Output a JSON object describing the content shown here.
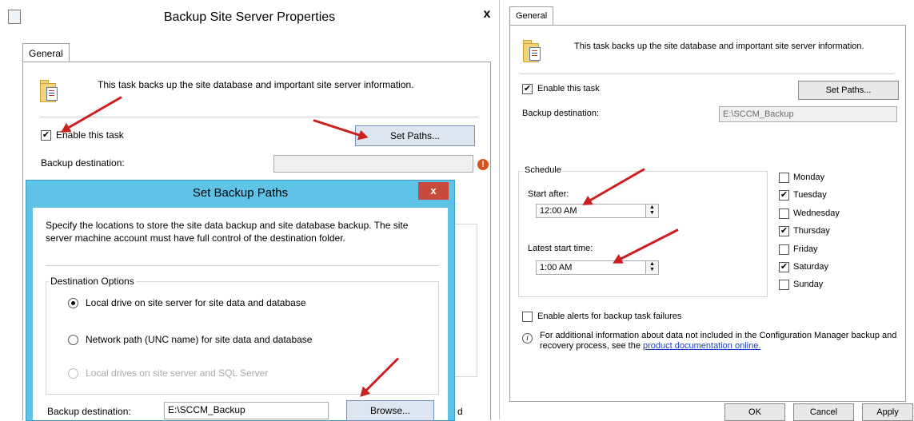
{
  "left_dialog": {
    "title": "Backup Site Server Properties",
    "close_glyph": "x",
    "tab": "General",
    "description": "This task backs up the site database and important site server information.",
    "enable_label": "Enable this task",
    "enable_checked": true,
    "set_paths_label": "Set Paths...",
    "backup_destination_label": "Backup destination:",
    "backup_destination_value": "",
    "warning_icon": "error-icon"
  },
  "set_backup_paths": {
    "title": "Set Backup Paths",
    "close_glyph": "x",
    "instructions": "Specify the locations to store the site data backup and site database backup. The site server machine account must have full control of the destination folder.",
    "group_title": "Destination Options",
    "options": [
      {
        "label": "Local drive on site server for site data and database",
        "selected": true,
        "enabled": true
      },
      {
        "label": "Network path (UNC name) for site data and database",
        "selected": false,
        "enabled": true
      },
      {
        "label": "Local drives on site server and SQL Server",
        "selected": false,
        "enabled": false
      }
    ],
    "backup_destination_label": "Backup destination:",
    "backup_destination_value": "E:\\SCCM_Backup",
    "browse_label": "Browse...",
    "trailing_char": "d"
  },
  "right_panel": {
    "tab": "General",
    "description": "This task backs up the site database and important site server information.",
    "enable_label": "Enable this task",
    "enable_checked": true,
    "set_paths_label": "Set Paths...",
    "backup_destination_label": "Backup destination:",
    "backup_destination_value": "E:\\SCCM_Backup",
    "schedule_label": "Schedule",
    "start_after_label": "Start after:",
    "start_after_value": "12:00 AM",
    "latest_start_label": "Latest start time:",
    "latest_start_value": "1:00 AM",
    "days": [
      {
        "label": "Monday",
        "checked": false
      },
      {
        "label": "Tuesday",
        "checked": true
      },
      {
        "label": "Wednesday",
        "checked": false
      },
      {
        "label": "Thursday",
        "checked": true
      },
      {
        "label": "Friday",
        "checked": false
      },
      {
        "label": "Saturday",
        "checked": true
      },
      {
        "label": "Sunday",
        "checked": false
      }
    ],
    "alerts_label": "Enable alerts for backup task failures",
    "alerts_checked": false,
    "info_text_1": "For additional information about data not included in the Configuration Manager backup and",
    "info_text_2": "recovery process, see the ",
    "info_link": "product documentation online.",
    "ok_label": "OK",
    "cancel_label": "Cancel",
    "apply_label": "Apply"
  },
  "colors": {
    "accent_blue": "#5fc3e8",
    "close_red": "#c74a3a",
    "arrow_red": "#cc1f1f",
    "link_blue": "#1a3fc0"
  }
}
